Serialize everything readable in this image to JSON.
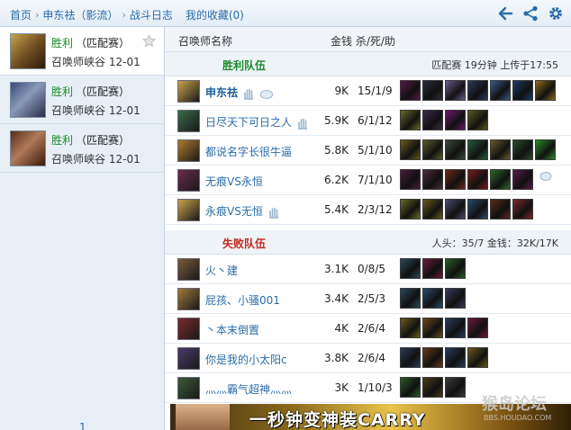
{
  "breadcrumb": {
    "home": "首页",
    "player": "申东祛（影流）",
    "page": "战斗日志",
    "favorites": "我的收藏(0)"
  },
  "toolbar": {
    "back_icon": "back-arrow-icon",
    "share_icon": "share-icon",
    "settings_icon": "gear-icon"
  },
  "sidebar": {
    "records": [
      {
        "result": "胜利",
        "mode": "（匹配赛）",
        "map": "召唤师峡谷",
        "date": "12-01",
        "active": true
      },
      {
        "result": "胜利",
        "mode": "（匹配赛）",
        "map": "召唤师峡谷",
        "date": "12-01",
        "active": false
      },
      {
        "result": "胜利",
        "mode": "（匹配赛）",
        "map": "召唤师峡谷",
        "date": "12-01",
        "active": false
      }
    ],
    "page_number": "1"
  },
  "table": {
    "col_name": "召唤师名称",
    "col_stats": "金钱 杀/死/助"
  },
  "win": {
    "title": "胜利队伍",
    "meta": "匹配赛 19分钟 上传于17:55",
    "color": "#1b8a2a",
    "players": [
      {
        "name": "申东祛",
        "gold": "9K",
        "kda": "15/1/9",
        "me": true,
        "badges": [
          "hand-icon",
          "cloud-icon"
        ],
        "items": [
          "#5a1a4a",
          "#2a2a3a",
          "#6a5a8a",
          "#2a3a5a",
          "#3a5a8a",
          "#1a3a6a",
          "#8a6a1a"
        ]
      },
      {
        "name": "日尽天下可日之人",
        "gold": "5.9K",
        "kda": "6/1/12",
        "me": false,
        "badges": [
          "hand-icon"
        ],
        "items": [
          "#6a6a2a",
          "#3a2a4a",
          "#6a1a6a",
          "#5a5a1a"
        ]
      },
      {
        "name": "都说名字长很牛逼",
        "gold": "5.8K",
        "kda": "5/1/10",
        "me": false,
        "badges": [],
        "items": [
          "#6a5a1a",
          "#5a5a2a",
          "#3a4a3a",
          "#2a5a3a",
          "#6a5a2a",
          "#2a4a2a",
          "#2a8a2a"
        ]
      },
      {
        "name": "无痕VS永恒",
        "gold": "6.2K",
        "kda": "7/1/10",
        "me": false,
        "badges": [],
        "items": [
          "#4a1a3a",
          "#4a2a3a",
          "#6a2a1a",
          "#7a1a1a",
          "#2a6a2a",
          "#5a1a4a"
        ],
        "tail": "cloud-icon"
      },
      {
        "name": "永痕VS无恒",
        "gold": "5.4K",
        "kda": "2/3/12",
        "me": false,
        "badges": [
          "hand-icon"
        ],
        "items": [
          "#6a6a2a",
          "#6a5a1a",
          "#4a4a6a",
          "#2a4a6a",
          "#5a2a1a",
          "#7a2a2a"
        ]
      }
    ]
  },
  "lose": {
    "title": "失败队伍",
    "meta": "人头：35/7 金钱：32K/17K",
    "color": "#c0281e",
    "players": [
      {
        "name": "火丶建",
        "gold": "3.1K",
        "kda": "0/8/5",
        "me": false,
        "badges": [],
        "items": [
          "#2a4a5a",
          "#6a1a3a",
          "#2a5a2a"
        ]
      },
      {
        "name": "屁孩、小骚001",
        "gold": "3.4K",
        "kda": "2/5/3",
        "me": false,
        "badges": [],
        "items": [
          "#2a4a5a",
          "#2a4a6a",
          "#3a3a5a"
        ]
      },
      {
        "name": "丶本末倒置",
        "gold": "4K",
        "kda": "2/6/4",
        "me": false,
        "badges": [],
        "items": [
          "#6a5a1a",
          "#6a4a1a",
          "#2a3a5a",
          "#6a1a3a"
        ]
      },
      {
        "name": "你是我的小太阳c",
        "gold": "3.8K",
        "kda": "2/6/4",
        "me": false,
        "badges": [],
        "items": [
          "#2a3a5a",
          "#6a3a1a",
          "#2a3a5a",
          "#6a5a1a"
        ]
      },
      {
        "name": "灬灬霸气超神灬灬",
        "gold": "3K",
        "kda": "1/10/3",
        "me": false,
        "badges": [],
        "items": [
          "#2a5a2a",
          "#4a3a1a",
          "#3a3a3a"
        ]
      }
    ]
  },
  "ad": {
    "text": "一秒钟变神装CARRY"
  },
  "watermark": {
    "main": "猴岛论坛",
    "sub": "BBS.HOUDAO.COM"
  }
}
